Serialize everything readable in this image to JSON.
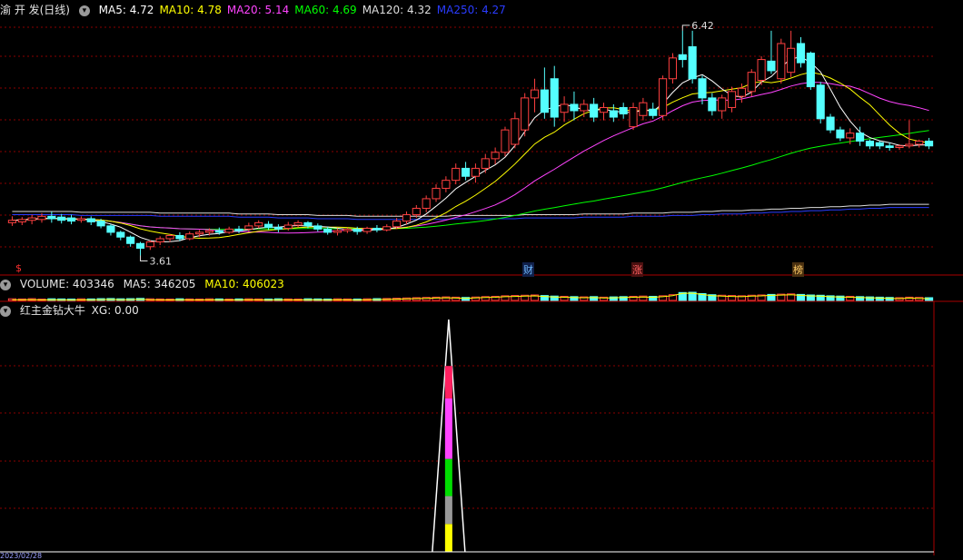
{
  "main": {
    "title": "渝 开 发(日线)",
    "ma_items": [
      {
        "label": "MA5: 4.72",
        "color": "#ffffff"
      },
      {
        "label": "MA10: 4.78",
        "color": "#ffff00"
      },
      {
        "label": "MA20: 5.14",
        "color": "#ff44ff"
      },
      {
        "label": "MA60: 4.69",
        "color": "#00ff00"
      },
      {
        "label": "MA120: 4.32",
        "color": "#dddddd"
      },
      {
        "label": "MA250: 4.27",
        "color": "#2a3cff"
      }
    ],
    "annotations": {
      "high": "6.42",
      "low": "3.61"
    },
    "markers": [
      {
        "label": "$",
        "color": "#ff3030",
        "bg": "#000000"
      },
      {
        "label": "财",
        "color": "#6fb8ff",
        "bg": "#10204a"
      },
      {
        "label": "涨",
        "color": "#ff6060",
        "bg": "#4a1010"
      },
      {
        "label": "榜",
        "color": "#ffcc66",
        "bg": "#4a3010"
      }
    ]
  },
  "volume": {
    "label": "VOLUME: 403346",
    "ma5": "MA5: 346205",
    "ma10": "MA10: 406023"
  },
  "indicator": {
    "name": "红主金钻大牛",
    "value": "XG: 0.00"
  },
  "footer": {
    "date": "2023/02/28"
  },
  "colors": {
    "up": "#ff4040",
    "down": "#54ffff",
    "grid": "#8b0000",
    "ma5": "#ffffff",
    "ma10": "#ffff00",
    "ma20": "#ff44ff",
    "ma60": "#00ff00",
    "ma120": "#dddddd",
    "ma250": "#2a3cff"
  },
  "chart_data": {
    "type": "candlestick",
    "price_range": [
      3.4,
      6.6
    ],
    "candles": [
      [
        4.02,
        4.05,
        3.98,
        4.1
      ],
      [
        4.03,
        4.06,
        3.99,
        4.09
      ],
      [
        4.05,
        4.08,
        4.0,
        4.12
      ],
      [
        4.06,
        4.1,
        4.02,
        4.14
      ],
      [
        4.1,
        4.07,
        4.02,
        4.16
      ],
      [
        4.09,
        4.05,
        4.01,
        4.13
      ],
      [
        4.08,
        4.04,
        4.0,
        4.12
      ],
      [
        4.05,
        4.07,
        4.02,
        4.1
      ],
      [
        4.07,
        4.03,
        3.99,
        4.1
      ],
      [
        4.04,
        3.98,
        3.95,
        4.07
      ],
      [
        3.98,
        3.9,
        3.86,
        4.0
      ],
      [
        3.9,
        3.84,
        3.8,
        3.92
      ],
      [
        3.84,
        3.76,
        3.72,
        3.86
      ],
      [
        3.76,
        3.7,
        3.61,
        3.78
      ],
      [
        3.72,
        3.78,
        3.68,
        3.8
      ],
      [
        3.78,
        3.82,
        3.74,
        3.85
      ],
      [
        3.82,
        3.86,
        3.78,
        3.88
      ],
      [
        3.86,
        3.82,
        3.79,
        3.9
      ],
      [
        3.82,
        3.88,
        3.8,
        3.91
      ],
      [
        3.88,
        3.9,
        3.84,
        3.93
      ],
      [
        3.9,
        3.92,
        3.86,
        3.95
      ],
      [
        3.92,
        3.9,
        3.87,
        3.96
      ],
      [
        3.9,
        3.94,
        3.88,
        3.97
      ],
      [
        3.94,
        3.92,
        3.89,
        3.98
      ],
      [
        3.94,
        3.98,
        3.91,
        4.02
      ],
      [
        3.98,
        4.02,
        3.95,
        4.05
      ],
      [
        4.0,
        3.96,
        3.93,
        4.04
      ],
      [
        3.96,
        3.94,
        3.9,
        4.0
      ],
      [
        3.95,
        3.99,
        3.92,
        4.03
      ],
      [
        3.99,
        4.02,
        3.96,
        4.05
      ],
      [
        4.02,
        3.98,
        3.95,
        4.04
      ],
      [
        3.98,
        3.94,
        3.91,
        4.01
      ],
      [
        3.94,
        3.9,
        3.87,
        3.97
      ],
      [
        3.9,
        3.92,
        3.86,
        3.95
      ],
      [
        3.92,
        3.94,
        3.89,
        3.96
      ],
      [
        3.94,
        3.91,
        3.87,
        3.97
      ],
      [
        3.91,
        3.95,
        3.88,
        3.97
      ],
      [
        3.95,
        3.93,
        3.9,
        3.99
      ],
      [
        3.93,
        3.97,
        3.91,
        4.0
      ],
      [
        3.97,
        4.04,
        3.94,
        4.08
      ],
      [
        4.04,
        4.12,
        4.0,
        4.16
      ],
      [
        4.12,
        4.2,
        4.08,
        4.24
      ],
      [
        4.2,
        4.32,
        4.15,
        4.36
      ],
      [
        4.32,
        4.45,
        4.28,
        4.5
      ],
      [
        4.45,
        4.55,
        4.4,
        4.6
      ],
      [
        4.55,
        4.7,
        4.5,
        4.76
      ],
      [
        4.7,
        4.6,
        4.55,
        4.78
      ],
      [
        4.6,
        4.7,
        4.52,
        4.76
      ],
      [
        4.7,
        4.82,
        4.64,
        4.88
      ],
      [
        4.82,
        4.9,
        4.75,
        4.96
      ],
      [
        4.9,
        5.18,
        4.85,
        5.22
      ],
      [
        5.0,
        5.32,
        4.95,
        5.4
      ],
      [
        5.18,
        5.58,
        5.1,
        5.64
      ],
      [
        5.58,
        5.68,
        5.4,
        5.82
      ],
      [
        5.68,
        5.4,
        5.32,
        5.96
      ],
      [
        5.82,
        5.34,
        5.22,
        5.98
      ],
      [
        5.4,
        5.5,
        5.28,
        5.6
      ],
      [
        5.5,
        5.42,
        5.3,
        5.66
      ],
      [
        5.42,
        5.5,
        5.34,
        5.56
      ],
      [
        5.5,
        5.34,
        5.28,
        5.58
      ],
      [
        5.4,
        5.46,
        5.3,
        5.52
      ],
      [
        5.42,
        5.34,
        5.28,
        5.5
      ],
      [
        5.46,
        5.38,
        5.32,
        5.52
      ],
      [
        5.22,
        5.46,
        5.18,
        5.52
      ],
      [
        5.36,
        5.52,
        5.3,
        5.58
      ],
      [
        5.44,
        5.36,
        5.32,
        5.52
      ],
      [
        5.36,
        5.82,
        5.3,
        5.86
      ],
      [
        5.82,
        6.08,
        5.76,
        6.14
      ],
      [
        6.12,
        6.06,
        5.96,
        6.42
      ],
      [
        6.22,
        5.82,
        5.76,
        6.42
      ],
      [
        5.82,
        5.58,
        5.5,
        5.86
      ],
      [
        5.58,
        5.42,
        5.36,
        5.64
      ],
      [
        5.42,
        5.58,
        5.32,
        5.62
      ],
      [
        5.46,
        5.66,
        5.4,
        5.72
      ],
      [
        5.6,
        5.7,
        5.52,
        5.76
      ],
      [
        5.66,
        5.9,
        5.6,
        5.94
      ],
      [
        5.8,
        6.06,
        5.74,
        6.1
      ],
      [
        6.04,
        5.92,
        5.88,
        6.42
      ],
      [
        5.82,
        6.26,
        5.76,
        6.32
      ],
      [
        5.9,
        6.2,
        5.84,
        6.42
      ],
      [
        6.26,
        6.02,
        5.96,
        6.34
      ],
      [
        6.14,
        5.72,
        5.68,
        6.16
      ],
      [
        5.74,
        5.32,
        5.26,
        5.78
      ],
      [
        5.34,
        5.18,
        5.14,
        5.38
      ],
      [
        5.18,
        5.08,
        5.04,
        5.22
      ],
      [
        5.08,
        5.14,
        5.0,
        5.2
      ],
      [
        5.14,
        5.04,
        4.98,
        5.22
      ],
      [
        5.04,
        4.98,
        4.94,
        5.06
      ],
      [
        5.02,
        4.98,
        4.94,
        5.04
      ],
      [
        4.98,
        4.96,
        4.92,
        5.02
      ],
      [
        4.96,
        4.98,
        4.93,
        5.0
      ],
      [
        4.98,
        5.0,
        4.95,
        5.3
      ],
      [
        5.0,
        5.04,
        4.96,
        5.06
      ],
      [
        5.04,
        4.98,
        4.94,
        5.08
      ]
    ],
    "volumes": [
      1.2,
      1.1,
      1.3,
      1.0,
      1.2,
      1.1,
      1.0,
      1.2,
      1.1,
      1.3,
      1.4,
      1.2,
      1.3,
      1.5,
      1.2,
      1.1,
      1.0,
      1.2,
      1.1,
      1.0,
      1.2,
      1.1,
      1.0,
      1.1,
      1.2,
      1.1,
      1.0,
      1.2,
      1.1,
      1.0,
      1.2,
      1.1,
      1.0,
      1.2,
      1.1,
      1.0,
      1.2,
      1.3,
      1.4,
      1.6,
      1.8,
      2.0,
      2.2,
      2.4,
      2.6,
      2.4,
      2.2,
      2.5,
      2.8,
      3.0,
      3.4,
      3.6,
      3.8,
      4.0,
      3.6,
      3.2,
      3.0,
      2.8,
      2.6,
      2.8,
      2.4,
      2.6,
      2.8,
      3.0,
      3.2,
      3.0,
      3.4,
      4.2,
      5.8,
      6.0,
      5.0,
      4.2,
      3.8,
      3.6,
      3.4,
      3.8,
      4.0,
      4.4,
      4.6,
      4.8,
      4.4,
      4.0,
      3.8,
      3.4,
      3.2,
      3.0,
      2.8,
      2.6,
      2.4,
      2.2,
      2.0,
      2.4,
      2.2,
      2.0
    ],
    "ma250": [
      4.12,
      4.12,
      4.12,
      4.12,
      4.12,
      4.12,
      4.12,
      4.11,
      4.11,
      4.11,
      4.11,
      4.11,
      4.11,
      4.11,
      4.11,
      4.1,
      4.1,
      4.1,
      4.1,
      4.1,
      4.1,
      4.1,
      4.1,
      4.09,
      4.09,
      4.09,
      4.09,
      4.08,
      4.08,
      4.08,
      4.08,
      4.07,
      4.07,
      4.07,
      4.07,
      4.06,
      4.06,
      4.06,
      4.06,
      4.06,
      4.06,
      4.06,
      4.06,
      4.06,
      4.06,
      4.07,
      4.07,
      4.07,
      4.07,
      4.07,
      4.07,
      4.07,
      4.08,
      4.08,
      4.08,
      4.08,
      4.08,
      4.08,
      4.09,
      4.09,
      4.09,
      4.09,
      4.09,
      4.1,
      4.1,
      4.1,
      4.1,
      4.11,
      4.11,
      4.11,
      4.12,
      4.12,
      4.13,
      4.13,
      4.13,
      4.14,
      4.14,
      4.15,
      4.15,
      4.16,
      4.16,
      4.17,
      4.17,
      4.18,
      4.18,
      4.19,
      4.19,
      4.2,
      4.2,
      4.21,
      4.21,
      4.21,
      4.21,
      4.21
    ],
    "indicator": {
      "value": 1,
      "index": 44
    }
  }
}
